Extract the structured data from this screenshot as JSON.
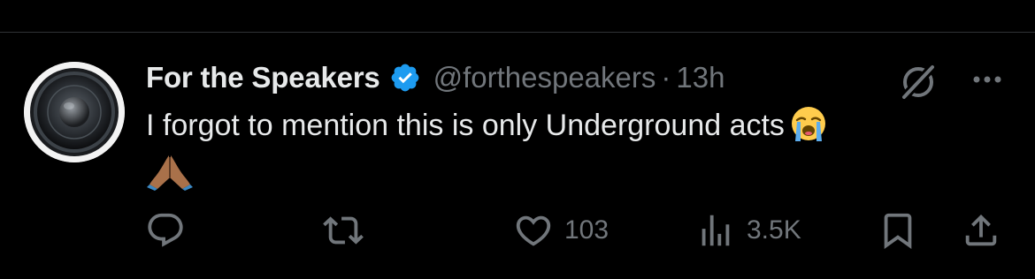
{
  "tweet": {
    "display_name": "For the Speakers",
    "handle": "@forthespeakers",
    "separator": "·",
    "time": "13h",
    "text": "I forgot to mention this is only Underground acts",
    "emojis": [
      "loudly-crying-face",
      "folded-hands"
    ]
  },
  "icons": {
    "verified": "verified-badge-icon",
    "grok": "grok-icon",
    "more": "more-options-icon"
  },
  "actions": {
    "reply": {
      "icon": "reply-icon",
      "count": ""
    },
    "retweet": {
      "icon": "retweet-icon",
      "count": ""
    },
    "like": {
      "icon": "heart-icon",
      "count": "103"
    },
    "views": {
      "icon": "views-icon",
      "count": "3.5K"
    },
    "bookmark": {
      "icon": "bookmark-icon"
    },
    "share": {
      "icon": "share-icon"
    }
  },
  "colors": {
    "background": "#000000",
    "text_primary": "#e7e9ea",
    "text_secondary": "#71767b",
    "verified_blue": "#1d9bf0",
    "divider": "#2f3336"
  }
}
